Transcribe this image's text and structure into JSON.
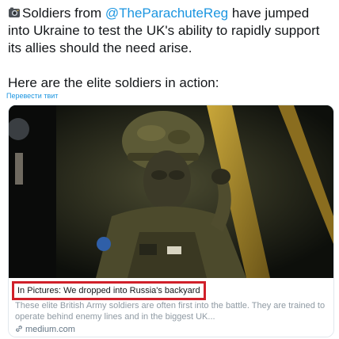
{
  "tweet": {
    "icon": "camera-icon",
    "line1_prefix": "Soldiers from ",
    "mention": "@TheParachuteReg",
    "line1_suffix": " have jumped into Ukraine to test the UK's ability to rapidly support its allies should the need arise.",
    "line2": "Here are the elite soldiers in action:",
    "translate_label": "Перевести твит"
  },
  "card": {
    "image_icon": "soldier-photo",
    "title": "In Pictures: We dropped into Russia's backyard",
    "description": "These elite British Army soldiers are often first into the battle. They are trained to operate behind enemy lines and in the biggest UK...",
    "domain_icon": "link-icon",
    "domain": "medium.com",
    "highlight_color": "#d0202a"
  },
  "colors": {
    "link": "#1b95e0",
    "text": "#14171a",
    "muted": "#8f9aa3"
  }
}
